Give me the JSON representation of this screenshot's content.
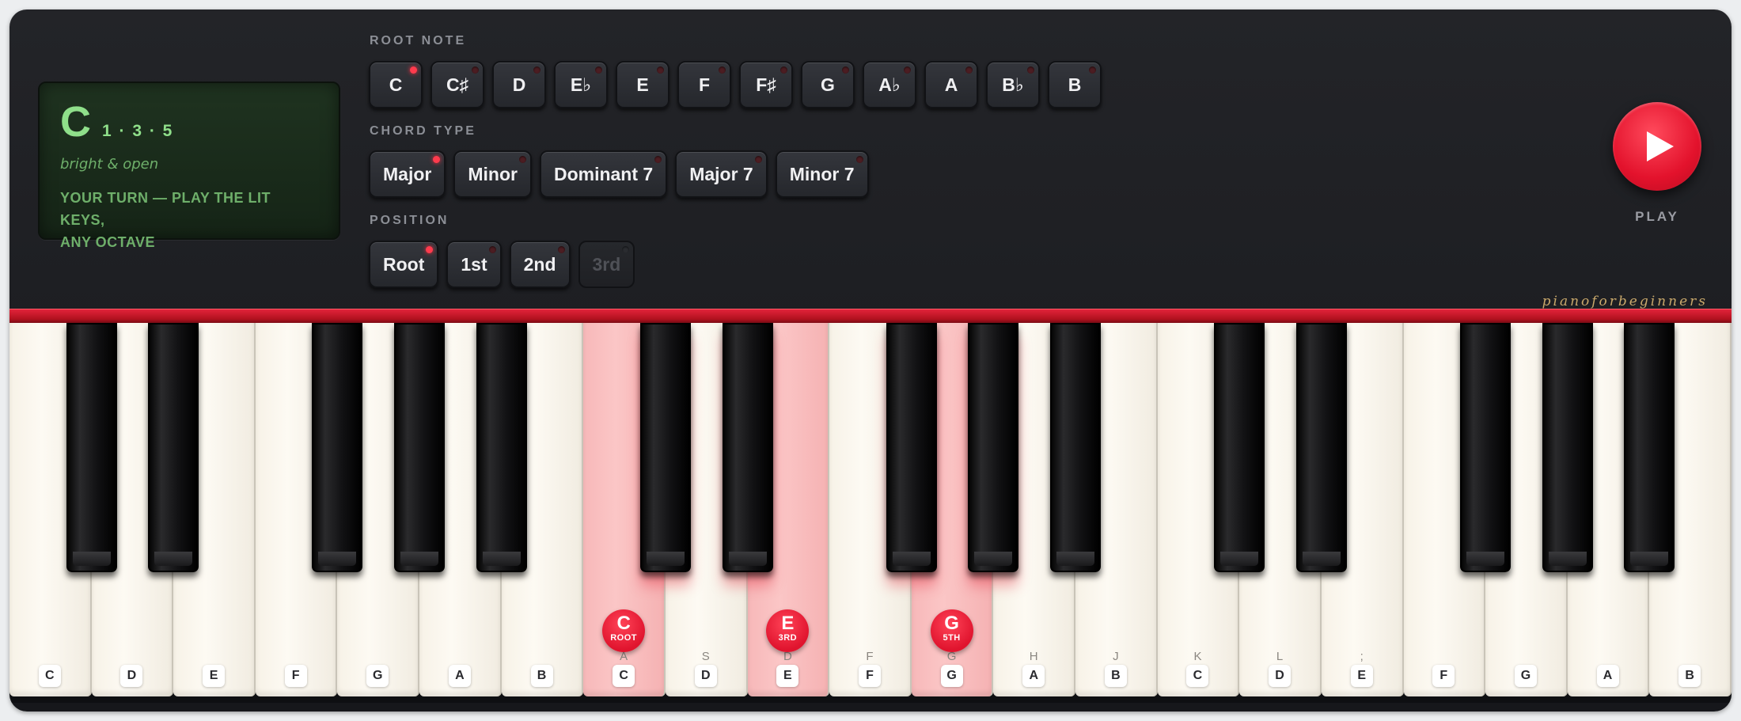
{
  "display": {
    "chord_root": "C",
    "formula": "1 · 3 · 5",
    "description": "bright & open",
    "instruction_line1": "YOUR TURN — PLAY THE LIT KEYS,",
    "instruction_line2": "ANY OCTAVE"
  },
  "sections": {
    "root_note_label": "ROOT NOTE",
    "chord_type_label": "CHORD TYPE",
    "position_label": "POSITION"
  },
  "root_notes": [
    {
      "label": "C",
      "active": true
    },
    {
      "label": "C♯",
      "active": false
    },
    {
      "label": "D",
      "active": false
    },
    {
      "label": "E♭",
      "active": false
    },
    {
      "label": "E",
      "active": false
    },
    {
      "label": "F",
      "active": false
    },
    {
      "label": "F♯",
      "active": false
    },
    {
      "label": "G",
      "active": false
    },
    {
      "label": "A♭",
      "active": false
    },
    {
      "label": "A",
      "active": false
    },
    {
      "label": "B♭",
      "active": false
    },
    {
      "label": "B",
      "active": false
    }
  ],
  "chord_types": [
    {
      "label": "Major",
      "active": true
    },
    {
      "label": "Minor",
      "active": false
    },
    {
      "label": "Dominant 7",
      "active": false
    },
    {
      "label": "Major 7",
      "active": false
    },
    {
      "label": "Minor 7",
      "active": false
    }
  ],
  "positions": [
    {
      "label": "Root",
      "active": true,
      "disabled": false
    },
    {
      "label": "1st",
      "active": false,
      "disabled": false
    },
    {
      "label": "2nd",
      "active": false,
      "disabled": false
    },
    {
      "label": "3rd",
      "active": false,
      "disabled": true
    }
  ],
  "play": {
    "label": "PLAY",
    "icon": "play-triangle-icon"
  },
  "brand": "pianoforbeginners",
  "colors": {
    "accent": "#e3122c",
    "display_text": "#8fdf8a",
    "lit_key": "#fbc6c6"
  },
  "white_keys": [
    {
      "note": "C",
      "hint": "",
      "lit": false
    },
    {
      "note": "D",
      "hint": "",
      "lit": false
    },
    {
      "note": "E",
      "hint": "",
      "lit": false
    },
    {
      "note": "F",
      "hint": "",
      "lit": false
    },
    {
      "note": "G",
      "hint": "",
      "lit": false
    },
    {
      "note": "A",
      "hint": "",
      "lit": false
    },
    {
      "note": "B",
      "hint": "",
      "lit": false
    },
    {
      "note": "C",
      "hint": "A",
      "lit": true,
      "badge": {
        "note": "C",
        "degree": "ROOT"
      }
    },
    {
      "note": "D",
      "hint": "S",
      "lit": false
    },
    {
      "note": "E",
      "hint": "D",
      "lit": true,
      "badge": {
        "note": "E",
        "degree": "3RD"
      }
    },
    {
      "note": "F",
      "hint": "F",
      "lit": false
    },
    {
      "note": "G",
      "hint": "G",
      "lit": true,
      "badge": {
        "note": "G",
        "degree": "5TH"
      }
    },
    {
      "note": "A",
      "hint": "H",
      "lit": false
    },
    {
      "note": "B",
      "hint": "J",
      "lit": false
    },
    {
      "note": "C",
      "hint": "K",
      "lit": false
    },
    {
      "note": "D",
      "hint": "L",
      "lit": false
    },
    {
      "note": "E",
      "hint": ";",
      "lit": false
    },
    {
      "note": "F",
      "hint": "",
      "lit": false
    },
    {
      "note": "G",
      "hint": "",
      "lit": false
    },
    {
      "note": "A",
      "hint": "",
      "lit": false
    },
    {
      "note": "B",
      "hint": "",
      "lit": false
    }
  ]
}
